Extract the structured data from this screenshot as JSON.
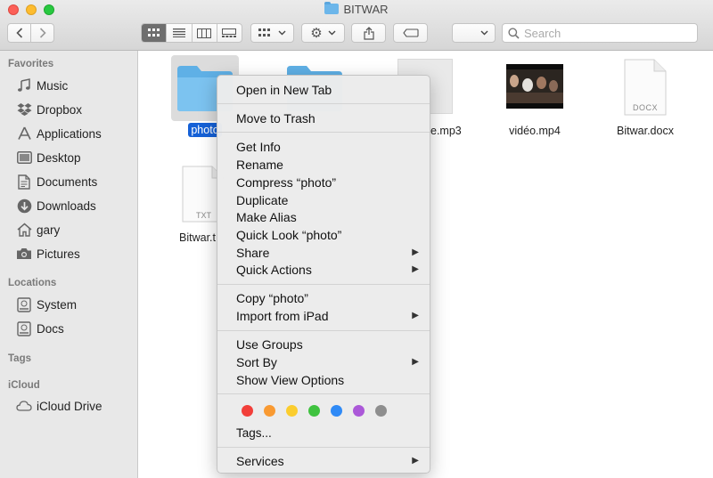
{
  "window": {
    "title": "BITWAR"
  },
  "toolbar": {
    "search_placeholder": "Search"
  },
  "sidebar": {
    "sections": {
      "favorites": "Favorites",
      "locations": "Locations",
      "tags": "Tags",
      "icloud": "iCloud"
    },
    "favorites": [
      {
        "label": "Music",
        "icon": "music-icon"
      },
      {
        "label": "Dropbox",
        "icon": "dropbox-icon"
      },
      {
        "label": "Applications",
        "icon": "applications-icon"
      },
      {
        "label": "Desktop",
        "icon": "desktop-icon"
      },
      {
        "label": "Documents",
        "icon": "documents-icon"
      },
      {
        "label": "Downloads",
        "icon": "downloads-icon"
      },
      {
        "label": "gary",
        "icon": "home-icon"
      },
      {
        "label": "Pictures",
        "icon": "camera-icon"
      }
    ],
    "locations": [
      {
        "label": "System",
        "icon": "disk-icon"
      },
      {
        "label": "Docs",
        "icon": "disk-icon"
      }
    ],
    "icloud": [
      {
        "label": "iCloud Drive",
        "icon": "cloud-icon"
      }
    ]
  },
  "files": {
    "photo": "photo",
    "mp3": "e.mp3",
    "video": "vidéo.mp4",
    "docx": "Bitwar.docx",
    "docx_badge": "DOCX",
    "txt": "Bitwar.t",
    "txt_badge": "TXT"
  },
  "context_menu": {
    "open_new_tab": "Open in New Tab",
    "move_to_trash": "Move to Trash",
    "get_info": "Get Info",
    "rename": "Rename",
    "compress": "Compress “photo”",
    "duplicate": "Duplicate",
    "make_alias": "Make Alias",
    "quick_look": "Quick Look “photo”",
    "share": "Share",
    "quick_actions": "Quick Actions",
    "copy": "Copy “photo”",
    "import_ipad": "Import from iPad",
    "use_groups": "Use Groups",
    "sort_by": "Sort By",
    "show_view_options": "Show View Options",
    "tags": "Tags...",
    "services": "Services",
    "tag_colors": [
      "#f23f3a",
      "#f99a32",
      "#fbcd2e",
      "#3fc23f",
      "#2f8af6",
      "#ab58d8",
      "#8e8e8e"
    ]
  }
}
